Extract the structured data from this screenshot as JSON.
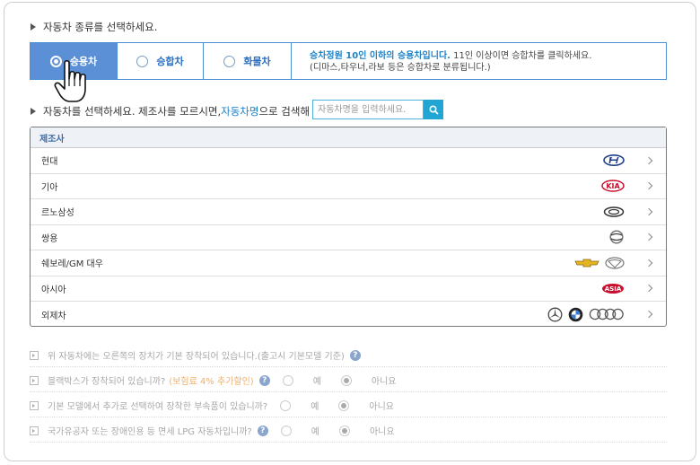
{
  "type_section": {
    "title": "자동차 종류를 선택하세요.",
    "options": [
      {
        "label": "승용차",
        "selected": true
      },
      {
        "label": "승합차",
        "selected": false
      },
      {
        "label": "화물차",
        "selected": false
      }
    ],
    "info_highlight": "승차정원 10인 이하의 승용차입니다.",
    "info_rest": " 11인 이상이면 승합차를 클릭하세요.",
    "info_line2": "(디마스,타우너,라보 등은 승합차로 분류됩니다.)"
  },
  "maker_section": {
    "title_pre": "자동차를 선택하세요. 제조사를 모르시면, ",
    "title_link": "자동차명",
    "title_post": "으로 검색해 보세요.",
    "search_placeholder": "자동차명을 입력하세요.",
    "table_header": "제조사",
    "makers": [
      {
        "name": "현대",
        "logos": [
          "hyundai-logo"
        ]
      },
      {
        "name": "기아",
        "logos": [
          "kia-logo"
        ]
      },
      {
        "name": "르노삼성",
        "logos": [
          "renault-samsung-logo"
        ]
      },
      {
        "name": "쌍용",
        "logos": [
          "ssangyong-logo"
        ]
      },
      {
        "name": "쉐보레/GM 대우",
        "logos": [
          "chevrolet-logo",
          "gm-daewoo-logo"
        ]
      },
      {
        "name": "아시아",
        "logos": [
          "asia-logo"
        ]
      },
      {
        "name": "외제차",
        "logos": [
          "mercedes-logo",
          "bmw-logo",
          "audi-logo"
        ]
      }
    ],
    "logo_texts": {
      "kia": "KIA",
      "asia": "ASIA"
    }
  },
  "questions": [
    {
      "text": "위 자동차에는 오른쪽의 장치가 기본 장착되어 있습니다.(출고시 기본모델 기준)",
      "note": "",
      "has_answers": false
    },
    {
      "text": "블랙박스가 장착되어 있습니까?",
      "note": "(보험료 4% 추가할인)",
      "has_answers": true
    },
    {
      "text": "기본 모델에서 추가로 선택하여 장착한 부속품이 있습니까?",
      "note": "",
      "has_answers": true
    },
    {
      "text": "국가유공자 또는 장애인용 등 면세 LPG 자동차입니까?",
      "note": "",
      "has_answers": true
    }
  ],
  "answer_yes": "예",
  "answer_no": "아니요",
  "help_mark": "?"
}
